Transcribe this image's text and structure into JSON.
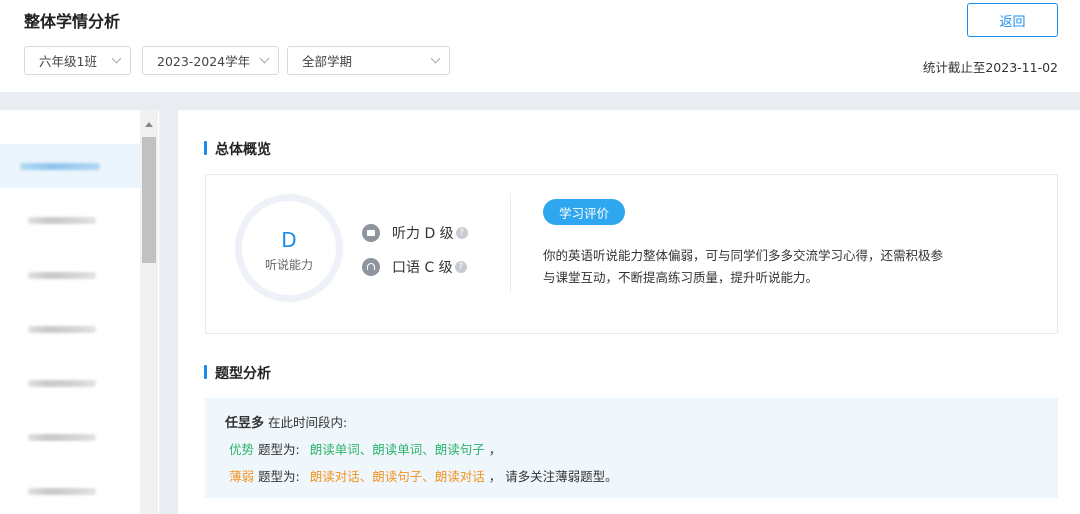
{
  "header": {
    "title": "整体学情分析",
    "back_label": "返回",
    "stat_date": "统计截止至2023-11-02"
  },
  "filters": {
    "class": "六年级1班",
    "year": "2023-2024学年",
    "term": "全部学期"
  },
  "overview": {
    "section_title": "总体概览",
    "grade": "D",
    "grade_label": "听说能力",
    "listening": "听力 D 级",
    "speaking": "口语 C 级",
    "eval_badge": "学习评价",
    "eval_text": "你的英语听说能力整体偏弱，可与同学们多多交流学习心得，还需积极参与课堂互动，不断提高练习质量，提升听说能力。"
  },
  "analysis": {
    "section_title": "题型分析",
    "student_name": "任昱多",
    "period_text": "在此时间段内:",
    "strong_label": "优势",
    "type_prefix": "题型为:",
    "strong_types": "朗读单词、朗读单词、朗读句子",
    "strong_suffix": "，",
    "weak_label": "薄弱",
    "weak_types": "朗读对话、朗读句子、朗读对话",
    "weak_suffix": "， 请多关注薄弱题型。"
  },
  "colors": {
    "accent": "#1a8ceb",
    "badge": "#2ea6f0",
    "strong": "#2cb36b",
    "weak": "#f39321"
  },
  "icons": {
    "listening": "headset-icon",
    "speaking": "microphone-icon",
    "help": "help-icon"
  }
}
